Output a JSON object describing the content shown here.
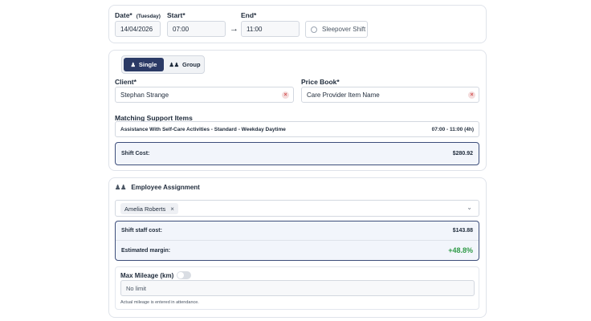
{
  "shift_time": {
    "date_label": "Date*",
    "day_label": "(Tuesday)",
    "date_value": "14/04/2026",
    "start_label": "Start*",
    "start_value": "07:00",
    "end_label": "End*",
    "end_value": "11:00",
    "sleepover_label": "Sleepover Shift"
  },
  "mode_toggle": {
    "single_label": "Single",
    "group_label": "Group",
    "selected": "Single"
  },
  "client": {
    "label": "Client*",
    "value": "Stephan Strange"
  },
  "price_book": {
    "label": "Price Book*",
    "value": "Care Provider Item Name"
  },
  "support_items": {
    "title": "Matching Support Items",
    "items": [
      {
        "name": "Assistance With Self-Care Activities - Standard - Weekday Daytime",
        "time": "07:00 - 11:00 (4h)"
      }
    ]
  },
  "shift_cost": {
    "label": "Shift Cost:",
    "value": "$280.92"
  },
  "employee_assignment": {
    "title": "Employee Assignment",
    "selected_employee": "Amelia Roberts",
    "staff_cost_label": "Shift staff cost:",
    "staff_cost_value": "$143.88",
    "margin_label": "Estimated margin:",
    "margin_value": "+48.8%"
  },
  "mileage": {
    "label": "Max Mileage (km)",
    "enabled": false,
    "placeholder": "No limit",
    "help_text": "Actual mileage is entered in attendance."
  },
  "colors": {
    "primary": "#2b3a66",
    "success": "#2f9a47",
    "danger": "#d14b4b"
  }
}
